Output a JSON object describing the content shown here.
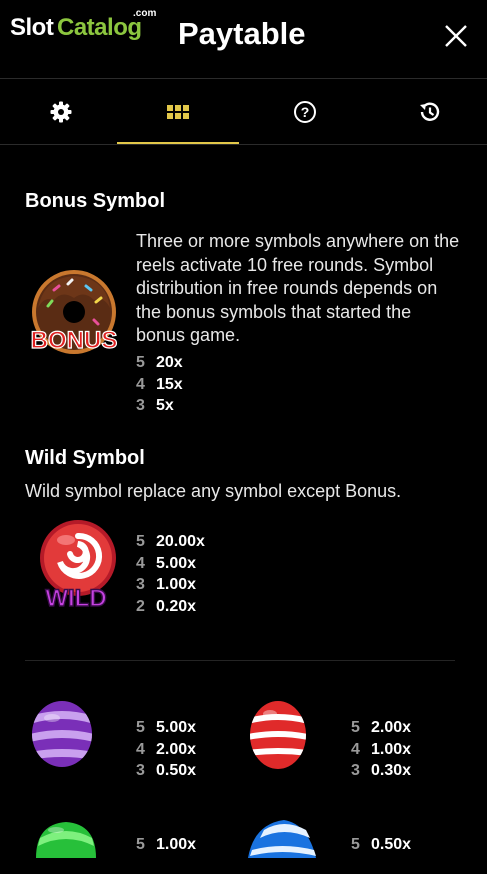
{
  "header": {
    "logo_slot": "Slot",
    "logo_catalog": "Catalog",
    "logo_com": ".com",
    "title": "Paytable"
  },
  "tabs": [
    {
      "icon": "gear-icon",
      "active": false
    },
    {
      "icon": "grid-icon",
      "active": true
    },
    {
      "icon": "help-icon",
      "active": false
    },
    {
      "icon": "history-icon",
      "active": false
    }
  ],
  "bonus": {
    "title": "Bonus Symbol",
    "description": "Three or more symbols anywhere on the reels activate 10 free rounds. Symbol distribution in free rounds depends on the bonus symbols that started the bonus game.",
    "symbol_label": "BONUS",
    "payouts": [
      {
        "n": "5",
        "v": "20x"
      },
      {
        "n": "4",
        "v": "15x"
      },
      {
        "n": "3",
        "v": "5x"
      }
    ]
  },
  "wild": {
    "title": "Wild Symbol",
    "description": "Wild symbol replace any symbol except Bonus.",
    "symbol_label": "WILD",
    "payouts": [
      {
        "n": "5",
        "v": "20.00x"
      },
      {
        "n": "4",
        "v": "5.00x"
      },
      {
        "n": "3",
        "v": "1.00x"
      },
      {
        "n": "2",
        "v": "0.20x"
      }
    ]
  },
  "symbols": [
    {
      "name": "purple-candy",
      "payouts": [
        {
          "n": "5",
          "v": "5.00x"
        },
        {
          "n": "4",
          "v": "2.00x"
        },
        {
          "n": "3",
          "v": "0.50x"
        }
      ]
    },
    {
      "name": "red-candy",
      "payouts": [
        {
          "n": "5",
          "v": "2.00x"
        },
        {
          "n": "4",
          "v": "1.00x"
        },
        {
          "n": "3",
          "v": "0.30x"
        }
      ]
    },
    {
      "name": "green-candy",
      "payouts": [
        {
          "n": "5",
          "v": "1.00x"
        }
      ]
    },
    {
      "name": "blue-candy",
      "payouts": [
        {
          "n": "5",
          "v": "0.50x"
        }
      ]
    }
  ],
  "colors": {
    "accent": "#e2c84a",
    "logo_green": "#8cc63f",
    "background": "#000000"
  }
}
